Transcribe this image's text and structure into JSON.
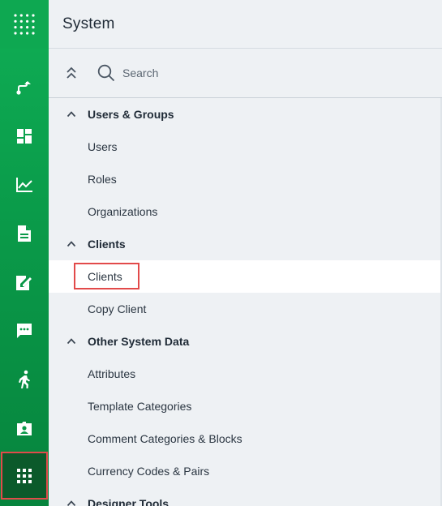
{
  "rail": {
    "items": [
      {
        "icon": "workflow-icon"
      },
      {
        "icon": "dashboard-icon"
      },
      {
        "icon": "line-chart-icon"
      },
      {
        "icon": "document-icon"
      },
      {
        "icon": "edit-document-icon"
      },
      {
        "icon": "comment-icon"
      },
      {
        "icon": "walking-person-icon"
      },
      {
        "icon": "contact-folder-icon"
      },
      {
        "icon": "apps-grid-icon",
        "active": true
      }
    ]
  },
  "panel": {
    "title": "System",
    "search_label": "Search"
  },
  "nav": {
    "users_groups": {
      "label": "Users & Groups",
      "items": [
        "Users",
        "Roles",
        "Organizations"
      ]
    },
    "clients": {
      "label": "Clients",
      "items": [
        "Clients",
        "Copy Client"
      ],
      "selected": "Clients"
    },
    "other_system_data": {
      "label": "Other System Data",
      "items": [
        "Attributes",
        "Template Categories",
        "Comment Categories & Blocks",
        "Currency Codes & Pairs"
      ]
    },
    "designer_tools": {
      "label": "Designer Tools"
    }
  },
  "colors": {
    "rail_green": "#0ea851",
    "rail_active": "#0b5a2b",
    "highlight_red": "#e24a4a",
    "panel_bg": "#eef1f4"
  }
}
